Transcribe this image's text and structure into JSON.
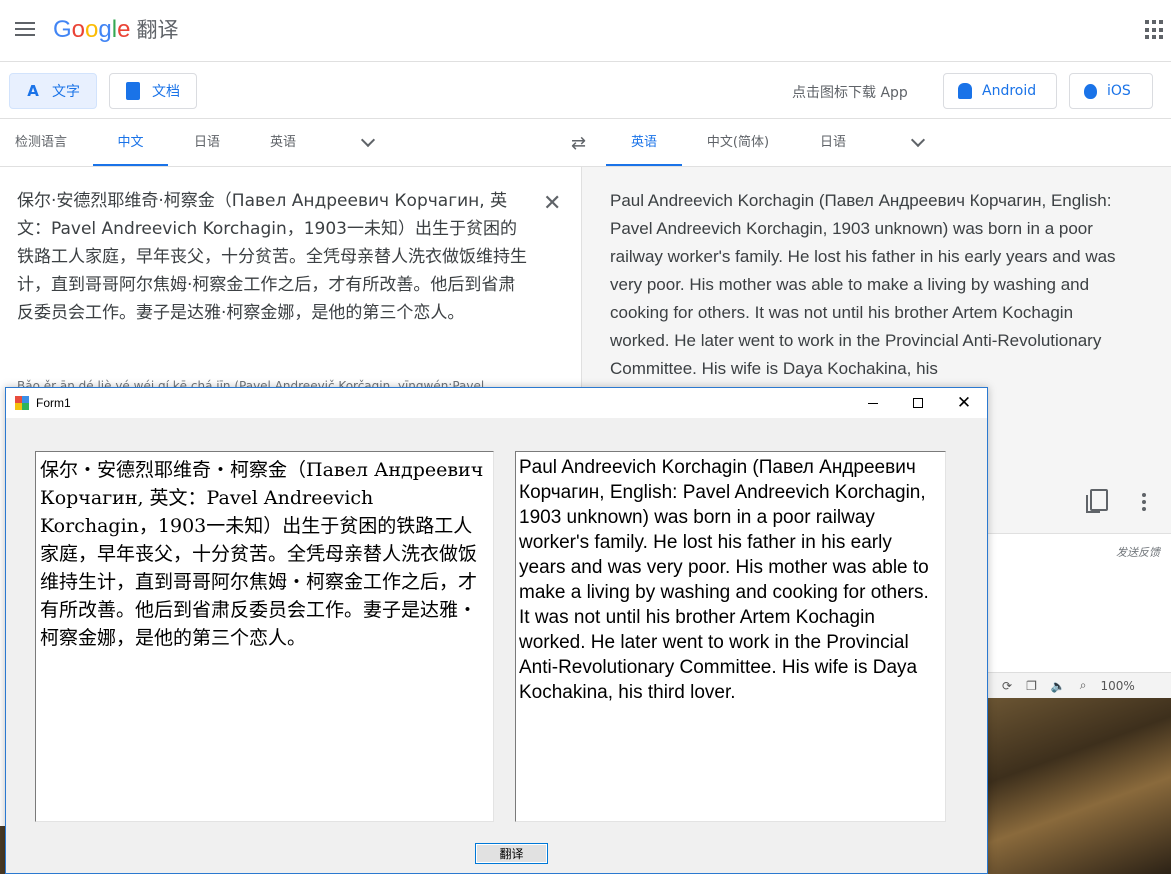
{
  "gt": {
    "product": "翻译",
    "modes": {
      "text": "文字",
      "docs": "文档"
    },
    "download_text": "点击图标下载 App",
    "android": "Android",
    "ios": "iOS",
    "source_langs": [
      "检测语言",
      "中文",
      "日语",
      "英语"
    ],
    "target_langs": [
      "英语",
      "中文(简体)",
      "日语"
    ],
    "source_text": "保尔·安德烈耶维奇·柯察金（Павел Андреевич Корчагин, 英文：Pavel Andreevich Korchagin，1903一未知）出生于贫困的铁路工人家庭，早年丧父，十分贫苦。全凭母亲替人洗衣做饭维持生计，直到哥哥阿尔焦姆·柯察金工作之后，才有所改善。他后到省肃反委员会工作。妻子是达雅·柯察金娜，是他的第三个恋人。",
    "romanization": "Bǎo ěr ān dé liè yé wéi qí kē chá jīn (Pavel Andreevič Korčagin, yīngwén:Pavel",
    "target_text": "Paul Andreevich Korchagin (Павел Андреевич Корчагин, English: Pavel Andreevich Korchagin, 1903 unknown) was born in a poor railway worker's family. He lost his father in his early years and was very poor. His mother was able to make a living by washing and cooking for others. It was not until his brother Artem Kochagin worked. He later went to work in the Provincial Anti-Revolutionary Committee. His wife is Daya Kochakina, his",
    "feedback": "发送反馈",
    "zoom": "100%"
  },
  "form": {
    "title": "Form1",
    "left_text": "保尔・安德烈耶维奇・柯察金（Павел Андреевич Корчагин, 英文：Pavel Andreevich Korchagin，1903一未知）出生于贫困的铁路工人家庭，早年丧父，十分贫苦。全凭母亲替人洗衣做饭维持生计，直到哥哥阿尔焦姆・柯察金工作之后，才有所改善。他后到省肃反委员会工作。妻子是达雅・柯察金娜，是他的第三个恋人。",
    "right_text": "Paul Andreevich Korchagin (Павел Андреевич Корчагин, English: Pavel Andreevich Korchagin, 1903 unknown) was born in a poor railway worker's family. He lost his father in his early years and was very poor. His mother was able to make a living by washing and cooking for others. It was not until his brother Artem Kochagin worked. He later went to work in the Provincial Anti-Revolutionary Committee. His wife is Daya Kochakina, his third lover.",
    "button": "翻译"
  },
  "colors": {
    "accent": "#1a73e8",
    "window_border": "#2b79d0"
  }
}
